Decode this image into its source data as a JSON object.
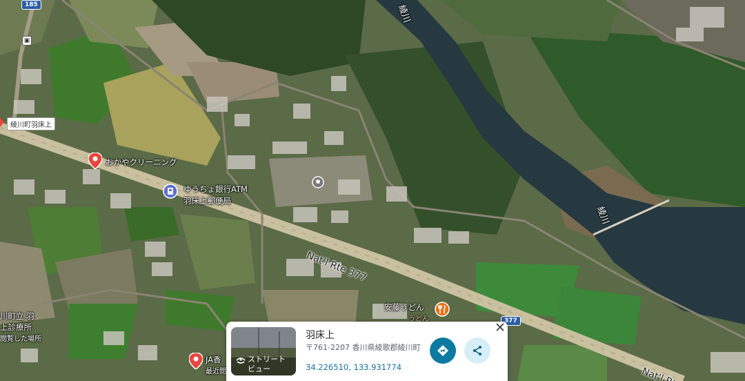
{
  "map": {
    "route_shield_top": "185",
    "route_shield_bottom": "377",
    "road_label": "Nat'l Rte 377",
    "road_label_2": "Nat'l Rte",
    "river_label_1": "綾川",
    "river_label_2": "綾川",
    "labels": {
      "town": "綾川町羽床上",
      "cleaning": "おかやクリーニング",
      "atm": "ゆうちょ銀行ATM",
      "post_office": "羽床上郵便局",
      "udon": "安藤うどん",
      "udon_sub": "うどん",
      "ja": "JA香",
      "ja_sub": "最近閲",
      "clinic_1": "川町立 羽",
      "clinic_2": "上診療所",
      "clinic_3": "閲覧した場所"
    }
  },
  "card": {
    "thumbnail_label": "ストリート\nビュー",
    "place_name": "羽床上",
    "address": "〒761-2207 香川県綾歌郡綾川町",
    "coordinates": "34.226510, 133.931774",
    "directions_icon": "directions-icon",
    "share_icon": "share-icon",
    "close_icon": "close-icon"
  },
  "colors": {
    "pin_red": "#e8453c",
    "pin_blue": "#5b6fd6",
    "pin_orange": "#e8711a",
    "button_teal": "#0b7aa0",
    "share_bg": "#d6eef7",
    "link_blue": "#1a73a8"
  }
}
